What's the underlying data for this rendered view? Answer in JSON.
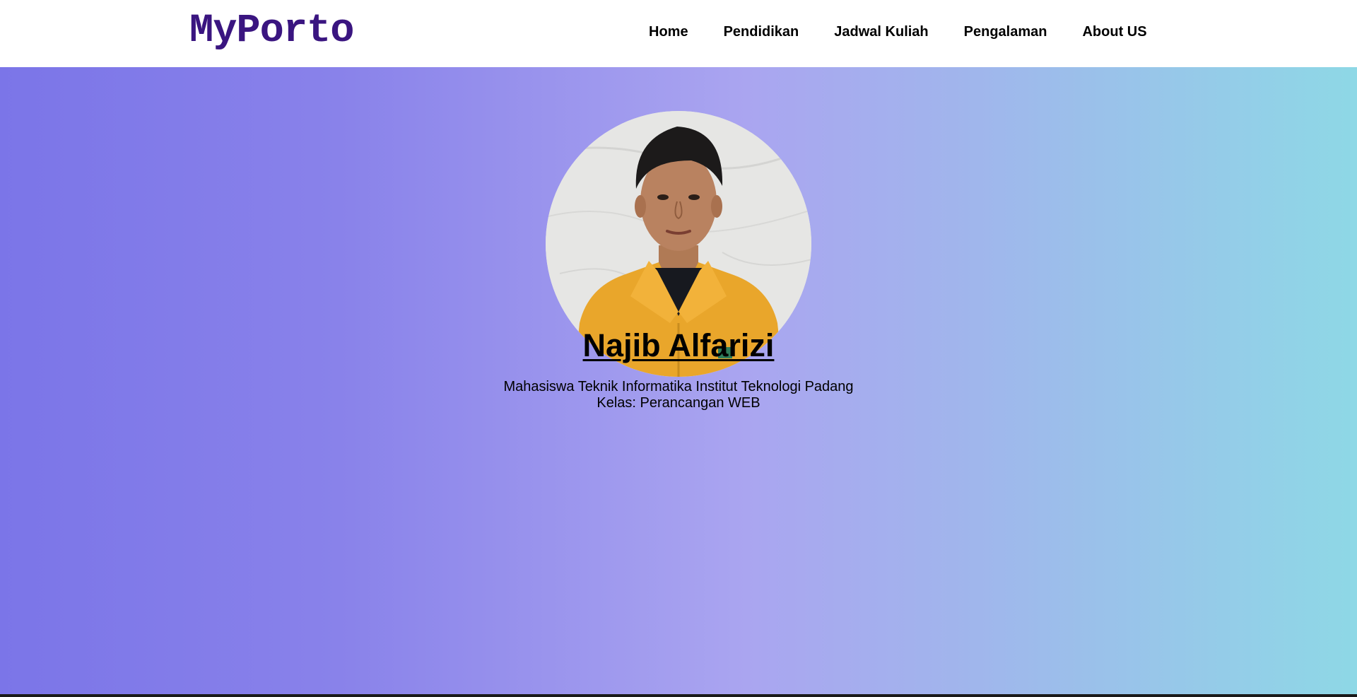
{
  "header": {
    "logo": "MyPorto",
    "nav": [
      "Home",
      "Pendidikan",
      "Jadwal Kuliah",
      "Pengalaman",
      "About US"
    ]
  },
  "profile": {
    "name": "Najib Alfarizi",
    "line1": "Mahasiswa Teknik Informatika Institut Teknologi Padang",
    "line2": "Kelas: Perancangan WEB"
  },
  "colors": {
    "logo": "#3a1580",
    "gradient_start": "#7b75e8",
    "gradient_mid": "#aaa5f0",
    "gradient_end": "#8ed8e6"
  }
}
